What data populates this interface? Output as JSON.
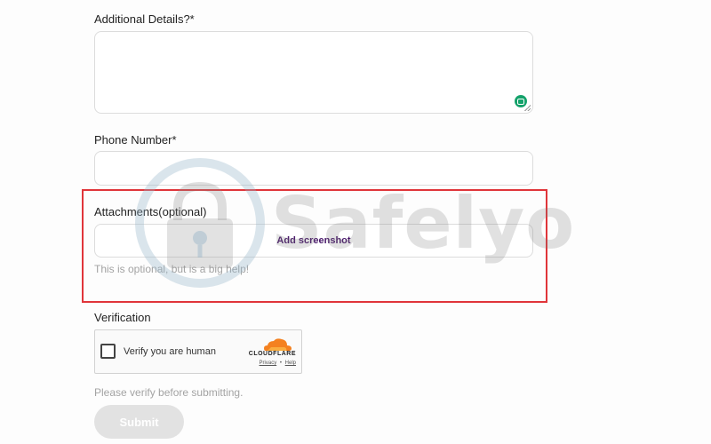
{
  "form": {
    "details_label": "Additional Details?*",
    "phone_label": "Phone Number*",
    "attachments_label": "Attachments(optional)",
    "add_screenshot": "Add screenshot",
    "attachments_hint": "This is optional, but is a big help!",
    "verification_label": "Verification",
    "verify_hint": "Please verify before submitting.",
    "submit": "Submit"
  },
  "captcha": {
    "checkbox_label": "Verify you are human",
    "brand": "CLOUDFLARE",
    "privacy": "Privacy",
    "separator": "•",
    "help": "Help"
  },
  "watermark": {
    "text": "Safelyo"
  },
  "colors": {
    "accent": "#4a1a6b",
    "highlight": "#e0353a",
    "grammarly": "#15a26b",
    "cloudflare_orange": "#f48120"
  }
}
